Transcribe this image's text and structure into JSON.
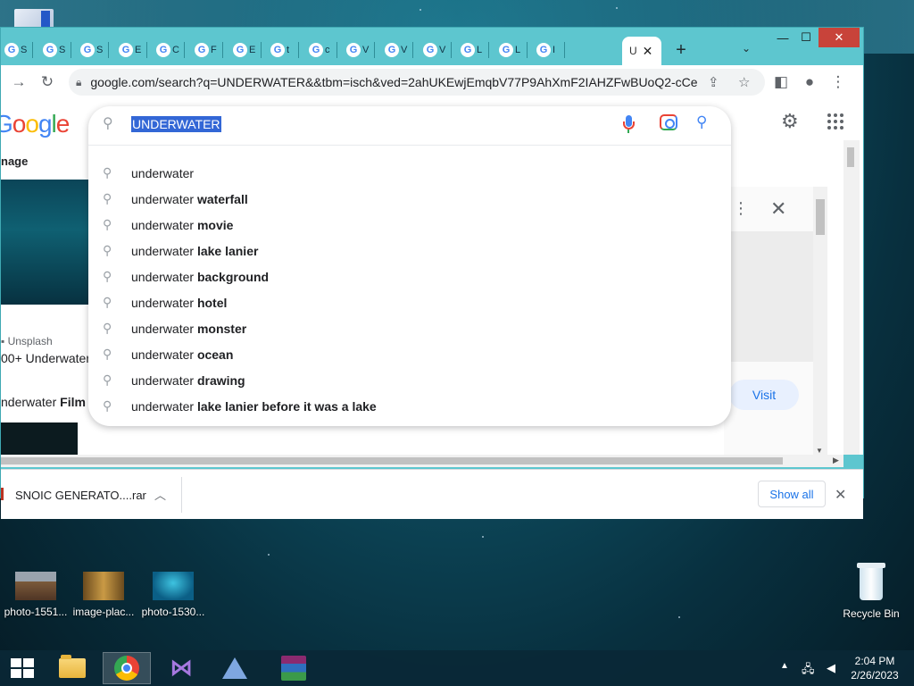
{
  "browser": {
    "tabs": [
      {
        "label": "S"
      },
      {
        "label": "S"
      },
      {
        "label": "S"
      },
      {
        "label": "E"
      },
      {
        "label": "C"
      },
      {
        "label": "F"
      },
      {
        "label": "E"
      },
      {
        "label": "t"
      },
      {
        "label": "c"
      },
      {
        "label": "V"
      },
      {
        "label": "V"
      },
      {
        "label": "V"
      },
      {
        "label": "L"
      },
      {
        "label": "L"
      },
      {
        "label": "I"
      }
    ],
    "active_tab": {
      "label": "U",
      "close": "✕"
    },
    "new_tab": "+",
    "url": "google.com/search?q=UNDERWATER&&tbm=isch&ved=2ahUKEwjEmqbV77P9AhXmF2IAHZFwBUoQ2-cCe..."
  },
  "google": {
    "logo": [
      "G",
      "o",
      "o",
      "g",
      "l",
      "e"
    ],
    "search_query": "UNDERWATER",
    "suggestions": [
      {
        "prefix": "underwater",
        "bold": ""
      },
      {
        "prefix": "underwater ",
        "bold": "waterfall"
      },
      {
        "prefix": "underwater ",
        "bold": "movie"
      },
      {
        "prefix": "underwater ",
        "bold": "lake lanier"
      },
      {
        "prefix": "underwater ",
        "bold": "background"
      },
      {
        "prefix": "underwater ",
        "bold": "hotel"
      },
      {
        "prefix": "underwater ",
        "bold": "monster"
      },
      {
        "prefix": "underwater ",
        "bold": "ocean"
      },
      {
        "prefix": "underwater ",
        "bold": "drawing"
      },
      {
        "prefix": "underwater ",
        "bold": "lake lanier before it was a lake"
      }
    ]
  },
  "results": {
    "left_title": "nage",
    "source": "Unsplash",
    "caption": "00+ Underwater",
    "film_prefix": "nderwater ",
    "film_bold": "Film",
    "visit_label": "Visit"
  },
  "downloads": {
    "file_name": "SNOIC GENERATO....rar",
    "show_all": "Show all"
  },
  "desktop": {
    "icons": [
      {
        "label": "photo-1551..."
      },
      {
        "label": "image-plac..."
      },
      {
        "label": "photo-1530..."
      }
    ],
    "recycle_bin": "Recycle Bin"
  },
  "taskbar": {
    "time": "2:04 PM",
    "date": "2/26/2023"
  },
  "colors": {
    "window_frame": "#5dc6cf",
    "accent_blue": "#1a73e8",
    "close_red": "#c8433a"
  }
}
